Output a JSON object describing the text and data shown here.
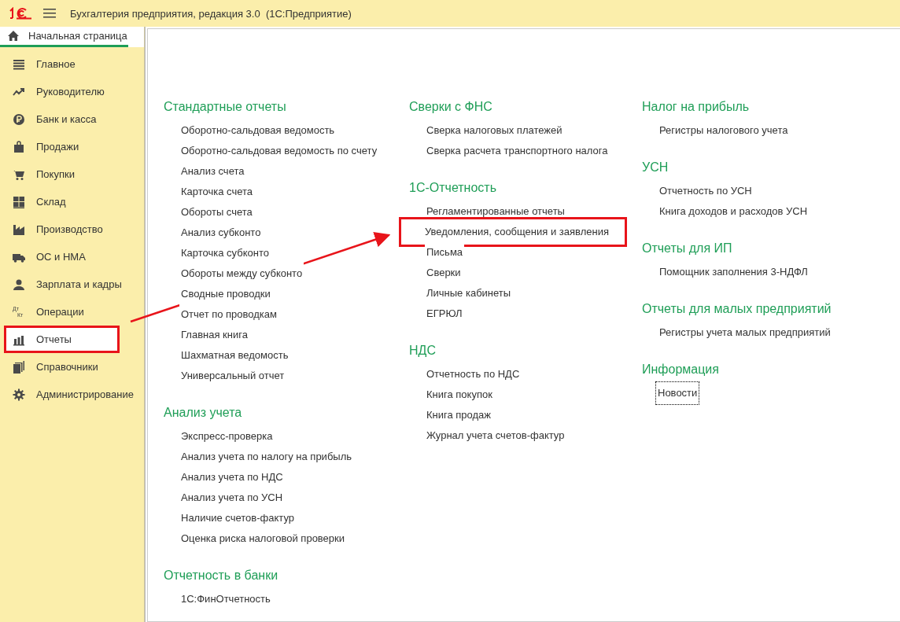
{
  "window": {
    "title": "Бухгалтерия предприятия, редакция 3.0  (1С:Предприятие)"
  },
  "tabs": [
    {
      "label": "Начальная страница",
      "selected": true
    }
  ],
  "sidebar": {
    "items": [
      {
        "kind": "list",
        "label": "Главное",
        "selected": false,
        "highlighted": false
      },
      {
        "kind": "trend",
        "label": "Руководителю",
        "selected": false,
        "highlighted": false
      },
      {
        "kind": "coin",
        "label": "Банк и касса",
        "selected": false,
        "highlighted": false
      },
      {
        "kind": "bag",
        "label": "Продажи",
        "selected": false,
        "highlighted": false
      },
      {
        "kind": "cart",
        "label": "Покупки",
        "selected": false,
        "highlighted": false
      },
      {
        "kind": "grid",
        "label": "Склад",
        "selected": false,
        "highlighted": false
      },
      {
        "kind": "factory",
        "label": "Производство",
        "selected": false,
        "highlighted": false
      },
      {
        "kind": "truck",
        "label": "ОС и НМА",
        "selected": false,
        "highlighted": false
      },
      {
        "kind": "person",
        "label": "Зарплата и кадры",
        "selected": false,
        "highlighted": false
      },
      {
        "kind": "dtkt",
        "label": "Операции",
        "selected": false,
        "highlighted": false,
        "icon_text": [
          "Дт",
          "Кт"
        ]
      },
      {
        "kind": "chart",
        "label": "Отчеты",
        "selected": true,
        "highlighted": true
      },
      {
        "kind": "books",
        "label": "Справочники",
        "selected": false,
        "highlighted": false
      },
      {
        "kind": "gear",
        "label": "Администрирование",
        "selected": false,
        "highlighted": false
      }
    ]
  },
  "columns": [
    {
      "groups": [
        {
          "title": "Стандартные отчеты",
          "links": [
            {
              "text": "Оборотно-сальдовая ведомость",
              "highlighted": false,
              "focused": false
            },
            {
              "text": "Оборотно-сальдовая ведомость по счету",
              "highlighted": false,
              "focused": false
            },
            {
              "text": "Анализ счета",
              "highlighted": false,
              "focused": false
            },
            {
              "text": "Карточка счета",
              "highlighted": false,
              "focused": false
            },
            {
              "text": "Обороты счета",
              "highlighted": false,
              "focused": false
            },
            {
              "text": "Анализ субконто",
              "highlighted": false,
              "focused": false
            },
            {
              "text": "Карточка субконто",
              "highlighted": false,
              "focused": false
            },
            {
              "text": "Обороты между субконто",
              "highlighted": false,
              "focused": false
            },
            {
              "text": "Сводные проводки",
              "highlighted": false,
              "focused": false
            },
            {
              "text": "Отчет по проводкам",
              "highlighted": false,
              "focused": false
            },
            {
              "text": "Главная книга",
              "highlighted": false,
              "focused": false
            },
            {
              "text": "Шахматная ведомость",
              "highlighted": false,
              "focused": false
            },
            {
              "text": "Универсальный отчет",
              "highlighted": false,
              "focused": false
            }
          ]
        },
        {
          "title": "Анализ учета",
          "links": [
            {
              "text": "Экспресс-проверка",
              "highlighted": false,
              "focused": false
            },
            {
              "text": "Анализ учета по налогу на прибыль",
              "highlighted": false,
              "focused": false
            },
            {
              "text": "Анализ учета по НДС",
              "highlighted": false,
              "focused": false
            },
            {
              "text": "Анализ учета по УСН",
              "highlighted": false,
              "focused": false
            },
            {
              "text": "Наличие счетов-фактур",
              "highlighted": false,
              "focused": false
            },
            {
              "text": "Оценка риска налоговой проверки",
              "highlighted": false,
              "focused": false
            }
          ]
        },
        {
          "title": "Отчетность в банки",
          "links": [
            {
              "text": "1С:ФинОтчетность",
              "highlighted": false,
              "focused": false
            }
          ]
        }
      ]
    },
    {
      "groups": [
        {
          "title": "Сверки с ФНС",
          "links": [
            {
              "text": "Сверка налоговых платежей",
              "highlighted": false,
              "focused": false
            },
            {
              "text": "Сверка расчета транспортного налога",
              "highlighted": false,
              "focused": false
            }
          ]
        },
        {
          "title": "1С-Отчетность",
          "links": [
            {
              "text": "Регламентированные отчеты",
              "highlighted": false,
              "focused": false
            },
            {
              "text": "Уведомления, сообщения и заявления",
              "highlighted": true,
              "focused": false
            },
            {
              "text": "Письма",
              "highlighted": false,
              "focused": false
            },
            {
              "text": "Сверки",
              "highlighted": false,
              "focused": false
            },
            {
              "text": "Личные кабинеты",
              "highlighted": false,
              "focused": false
            },
            {
              "text": "ЕГРЮЛ",
              "highlighted": false,
              "focused": false
            }
          ]
        },
        {
          "title": "НДС",
          "links": [
            {
              "text": "Отчетность по НДС",
              "highlighted": false,
              "focused": false
            },
            {
              "text": "Книга покупок",
              "highlighted": false,
              "focused": false
            },
            {
              "text": "Книга продаж",
              "highlighted": false,
              "focused": false
            },
            {
              "text": "Журнал учета счетов-фактур",
              "highlighted": false,
              "focused": false
            }
          ]
        }
      ]
    },
    {
      "groups": [
        {
          "title": "Налог на прибыль",
          "links": [
            {
              "text": "Регистры налогового учета",
              "highlighted": false,
              "focused": false
            }
          ]
        },
        {
          "title": "УСН",
          "links": [
            {
              "text": "Отчетность по УСН",
              "highlighted": false,
              "focused": false
            },
            {
              "text": "Книга доходов и расходов УСН",
              "highlighted": false,
              "focused": false
            }
          ]
        },
        {
          "title": "Отчеты для ИП",
          "links": [
            {
              "text": "Помощник заполнения 3-НДФЛ",
              "highlighted": false,
              "focused": false
            }
          ]
        },
        {
          "title": "Отчеты для малых предприятий",
          "links": [
            {
              "text": "Регистры учета малых предприятий",
              "highlighted": false,
              "focused": false
            }
          ]
        },
        {
          "title": "Информация",
          "links": [
            {
              "text": "Новости",
              "highlighted": false,
              "focused": true
            }
          ]
        }
      ]
    }
  ]
}
